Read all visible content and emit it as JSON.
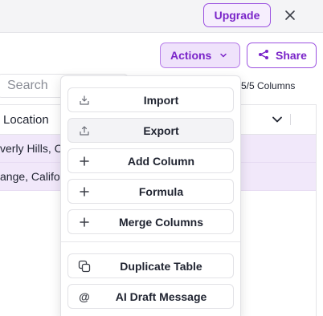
{
  "header": {
    "upgrade_label": "Upgrade"
  },
  "toolbar": {
    "actions_label": "Actions",
    "share_label": "Share"
  },
  "search": {
    "placeholder": "Search"
  },
  "columns_indicator": "5/5 Columns",
  "table": {
    "column_header": "Location",
    "rows": [
      "verly Hills, C",
      "ange, Califo"
    ]
  },
  "menu": {
    "items": [
      {
        "label": "Import",
        "icon": "import-icon"
      },
      {
        "label": "Export",
        "icon": "export-icon"
      },
      {
        "label": "Add Column",
        "icon": "plus-icon"
      },
      {
        "label": "Formula",
        "icon": "plus-icon"
      },
      {
        "label": "Merge Columns",
        "icon": "plus-icon"
      },
      {
        "label": "Duplicate Table",
        "icon": "copy-icon"
      },
      {
        "label": "AI Draft Message",
        "icon": "at-icon"
      }
    ]
  },
  "colors": {
    "accent": "#7a24c9",
    "accent_border": "#9b51e0",
    "row_highlight": "#f1e8fa"
  }
}
